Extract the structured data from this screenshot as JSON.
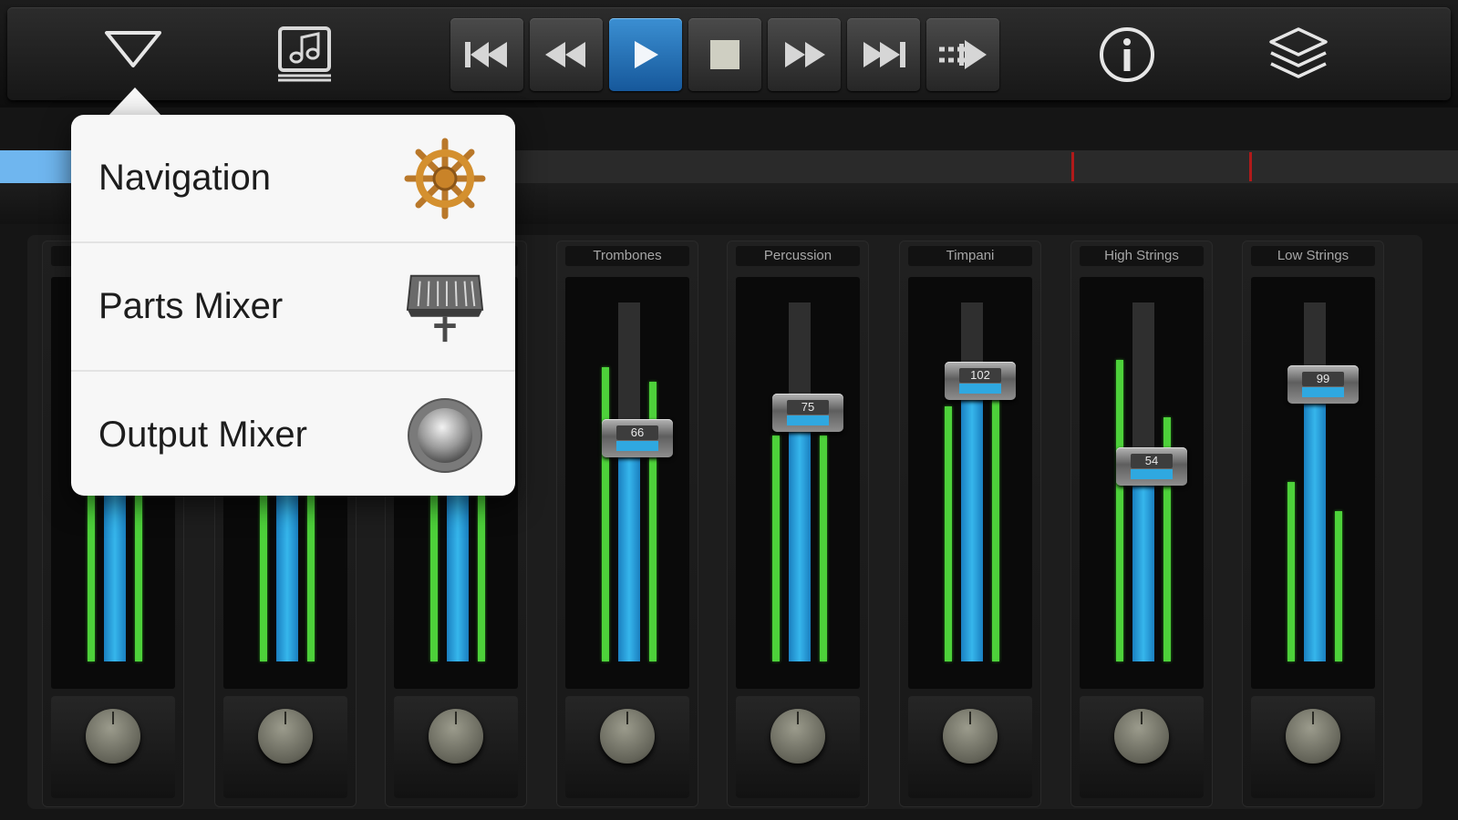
{
  "toolbar": {
    "menu_icon": "triangle-down-icon",
    "score_icon": "music-note-icon",
    "transport": [
      {
        "name": "skip-to-start",
        "icon": "skip-start-icon",
        "active": false
      },
      {
        "name": "rewind",
        "icon": "rewind-icon",
        "active": false
      },
      {
        "name": "play",
        "icon": "play-icon",
        "active": true
      },
      {
        "name": "stop",
        "icon": "stop-icon",
        "active": false
      },
      {
        "name": "fast-forward",
        "icon": "fast-forward-icon",
        "active": false
      },
      {
        "name": "skip-to-end",
        "icon": "skip-end-icon",
        "active": false
      },
      {
        "name": "tempo",
        "icon": "tempo-arrow-icon",
        "active": false
      }
    ],
    "info_icon": "info-icon",
    "layers_icon": "layers-icon",
    "accent": "#2a7dc4"
  },
  "timeline": {
    "progress": 0.05,
    "markers": [
      0.735,
      0.857
    ],
    "marker_color": "#b01a1a"
  },
  "popover": {
    "items": [
      {
        "label": "Navigation",
        "icon": "ship-wheel-icon"
      },
      {
        "label": "Parts Mixer",
        "icon": "mixer-desk-icon"
      },
      {
        "label": "Output Mixer",
        "icon": "knob-icon"
      }
    ]
  },
  "mixer": {
    "channels": [
      {
        "label": "",
        "value": "",
        "level": 0.55,
        "meter_left": 0.6,
        "meter_right": 0.6
      },
      {
        "label": "",
        "value": "",
        "level": 0.55,
        "meter_left": 0.6,
        "meter_right": 0.6
      },
      {
        "label": "",
        "value": "",
        "level": 0.55,
        "meter_left": 0.6,
        "meter_right": 0.6
      },
      {
        "label": "Trombones",
        "value": "66",
        "level": 0.64,
        "meter_left": 0.82,
        "meter_right": 0.78
      },
      {
        "label": "Percussion",
        "value": "75",
        "level": 0.71,
        "meter_left": 0.63,
        "meter_right": 0.63
      },
      {
        "label": "Timpani",
        "value": "102",
        "level": 0.8,
        "meter_left": 0.71,
        "meter_right": 0.73
      },
      {
        "label": "High Strings",
        "value": "54",
        "level": 0.56,
        "meter_left": 0.84,
        "meter_right": 0.68
      },
      {
        "label": "Low Strings",
        "value": "99",
        "level": 0.79,
        "meter_left": 0.5,
        "meter_right": 0.42
      }
    ],
    "meter_color": "#4dd13a",
    "fill_color": "#2fa8e0"
  }
}
